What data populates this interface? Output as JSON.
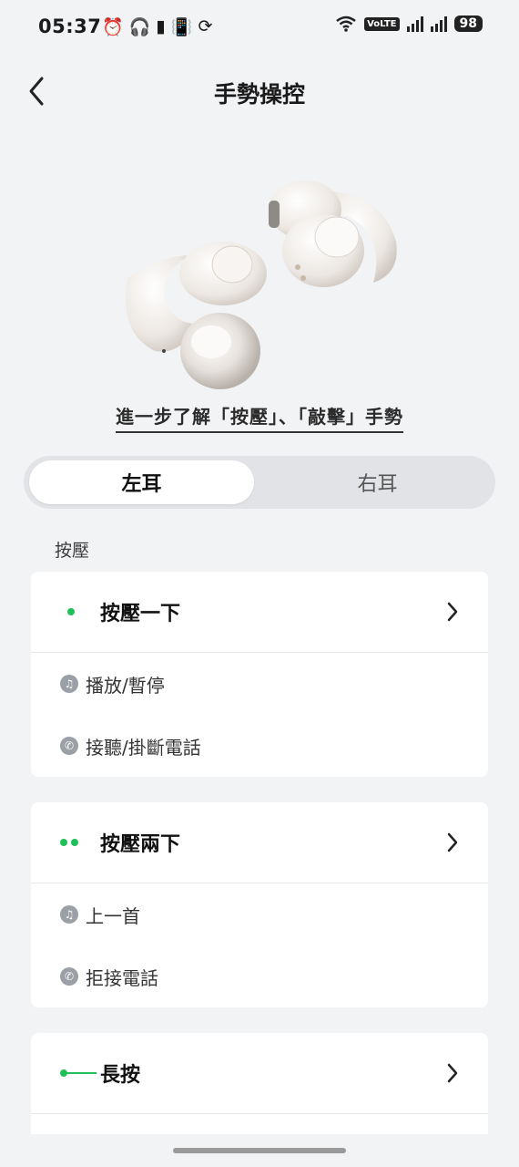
{
  "status_bar": {
    "time": "05:37",
    "left_icons": [
      "alarm-icon",
      "headphones-icon",
      "battery-small-icon",
      "vibrate-icon",
      "sync-icon"
    ],
    "volte": "VoLTE",
    "battery": "98"
  },
  "header": {
    "title": "手勢操控"
  },
  "learn_more": "進一步了解「按壓」、「敲擊」手勢",
  "ear_tabs": {
    "left": "左耳",
    "right": "右耳",
    "selected": "left"
  },
  "section_label": "按壓",
  "cards": [
    {
      "title": "按壓一下",
      "indicator": "single-dot",
      "items": [
        {
          "icon": "music-note-icon",
          "label": "播放/暫停"
        },
        {
          "icon": "phone-icon",
          "label": "接聽/掛斷電話"
        }
      ]
    },
    {
      "title": "按壓兩下",
      "indicator": "double-dot",
      "items": [
        {
          "icon": "music-note-icon",
          "label": "上一首"
        },
        {
          "icon": "phone-icon",
          "label": "拒接電話"
        }
      ]
    },
    {
      "title": "長按",
      "indicator": "long-press",
      "items": []
    }
  ],
  "colors": {
    "accent_green": "#1fbf5a",
    "background": "#f2f3f5"
  }
}
